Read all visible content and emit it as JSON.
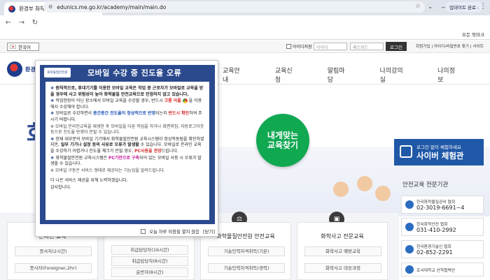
{
  "browser": {
    "tab_title": "환경부 화학물질안전원 교육시...",
    "tab_close": "×",
    "new_tab": "+",
    "url": "edunics.me.go.kr/academy/main/main.do",
    "update_label": "업데이트 완료 :",
    "bookmarks_all": "모든 북마크",
    "win_min": "—",
    "win_max": "☐",
    "win_close": "✕",
    "tab_dropdown": "⌄"
  },
  "utility": {
    "language": "한국어",
    "id_save": "아이디저장",
    "id_placeholder": "아이디",
    "pw_placeholder": "패스워드",
    "login": "로그인",
    "links": "회원가입 | 아이디/비밀번호 찾기 | 사이트"
  },
  "header": {
    "logo_text": "환경부 화",
    "nav": [
      "교육안내",
      "교육신청",
      "알림마당",
      "나의강의실",
      "나의정보"
    ]
  },
  "hero": {
    "big_text": "화",
    "bubble_line1": "내게맞는",
    "bubble_line2": "교육찾기",
    "cyber_small": "로그인 없이 체험하세요",
    "cyber_large": "사이버 체험관"
  },
  "pad": {
    "title": "안전교육 전문기관",
    "orgs": [
      {
        "name": "한국화학물질관리 협회",
        "tel": "02-3019-6691~4"
      },
      {
        "name": "한국화학안전 협회",
        "tel": "031-410-2992"
      },
      {
        "name": "한국환경기술인 협회",
        "tel": "02-852-2291"
      },
      {
        "name": "호서대학교 산학협력단",
        "tel": ""
      }
    ]
  },
  "cards": [
    {
      "title": "온라인 교육",
      "items": [
        "종사자(2시간)",
        "종사자(Foreigner,2hr)"
      ]
    },
    {
      "title": "",
      "items": [
        "취급담당자(16시간)",
        "취급담당자(8시간)",
        "운반자(8시간)"
      ]
    },
    {
      "title": "화학물질안전원 안전교육",
      "items": [
        "기술인력자격취득(기본)",
        "기술인력자격취득(경력)"
      ]
    },
    {
      "title": "화학사고 전문교육",
      "items": [
        "화학사고 예방교육",
        "화학사고 대응과정"
      ]
    }
  ],
  "popup": {
    "logo": "화학물질안전원",
    "title": "모바일 수강 중 진도율 오류",
    "p1_a": "원칙적으로, 휴대기기를 이용한 모바일 교육은 작업 중 근로자가 모바일로 교육을 받을 경우에 사고 위험성이 높아 화학물질 안전교육으로 인정하지 않고 있습니다.",
    "p2_a": "작업현장이 아닌 장소에서 모바일 교육을 수강할 경우, 반드시 ",
    "p2_red": "크롬 어플",
    "p2_b": " 을 이용해서 수강해야 합니다.",
    "p3_a": "모바일로 수강하면서 ",
    "p3_blue": "중간중간 진도율이 정상적으로 반영",
    "p3_b": "되는지 ",
    "p3_red": "반드시 확인",
    "p3_c": "하여 주시기 바랍니다.",
    "note1": "※ 모바일 온라인교육을 재생한 후 모바일을 다른 작업을 하거나 화면꺼짐, 자동로그아웃 등으로 진도율 반영이 안될 수 있습니다.",
    "p4_a": "현재 대부분의 모바일 기기에서 화학물질안전원 교육시스템이 정상작동됨을 확인하였지만, ",
    "p4_bold": "일부 기기나 설정 등의 사유로 오류가 발생할",
    "p4_b": " 수 있습니다. 모바일로 온라인 교육을 수강하기 어렵거나 진도율 체크가 안될 경우, ",
    "p4_red": "PC사용을 권장",
    "p4_c": "드립니다.",
    "p5_a": "화학물질안전원 교육시스템은 ",
    "p5_magenta": "PC기반으로 구축",
    "p5_b": "되어 있는 모바일 사용 시 오류가 발생할 수 있습니다.",
    "note2": "※ 모바일 구동은 서비스 형태로 제공되는 기능임을 알려드립니다.",
    "p6": "더 나은 서비스 제공을 위해 노력하겠습니다.",
    "p7": "감사합니다.",
    "hide_today": "오늘 하루 이창을 열지 않음",
    "close": "[닫기]"
  }
}
